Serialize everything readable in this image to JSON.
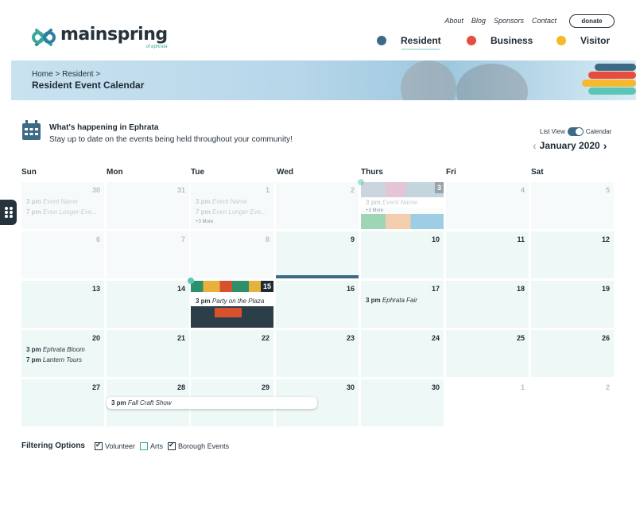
{
  "brand": {
    "name": "mainspring",
    "tagline": "of ephrata"
  },
  "top_links": [
    "About",
    "Blog",
    "Sponsors",
    "Contact"
  ],
  "donate_label": "donate",
  "main_nav": [
    {
      "label": "Resident",
      "color": "#3d6a85"
    },
    {
      "label": "Business",
      "color": "#e74c3c"
    },
    {
      "label": "Visitor",
      "color": "#f5b82e"
    }
  ],
  "banner": {
    "breadcrumb": "Home > Resident >",
    "title": "Resident Event Calendar"
  },
  "intro": {
    "title": "What's happening in Ephrata",
    "subtitle": "Stay up to date on the events being held throughout your community!"
  },
  "view_toggle": {
    "left": "List View",
    "right": "Calendar"
  },
  "month_label": "January 2020",
  "days_of_week": [
    "Sun",
    "Mon",
    "Tue",
    "Wed",
    "Thurs",
    "Fri",
    "Sat"
  ],
  "weeks": [
    [
      {
        "n": "30",
        "style": "faded",
        "events": [
          [
            "3 pm",
            "Event Name"
          ],
          [
            "7 pm",
            "Even Longer Eve..."
          ]
        ]
      },
      {
        "n": "31",
        "style": "faded",
        "events": []
      },
      {
        "n": "1",
        "style": "faded",
        "events": [
          [
            "3 pm",
            "Event Name"
          ],
          [
            "7 pm",
            "Even Longer Eve..."
          ]
        ],
        "more": "+3 More"
      },
      {
        "n": "2",
        "style": "faded",
        "events": []
      },
      {
        "n": "3",
        "style": "image-faded",
        "events": [
          [
            "3 pm",
            "Event Name"
          ]
        ],
        "more": "+3 More"
      },
      {
        "n": "4",
        "style": "faded",
        "events": []
      },
      {
        "n": "5",
        "style": "faded",
        "events": []
      }
    ],
    [
      {
        "n": "6",
        "style": "faded",
        "events": []
      },
      {
        "n": "7",
        "style": "faded",
        "events": []
      },
      {
        "n": "8",
        "style": "faded",
        "events": []
      },
      {
        "n": "9",
        "style": "normal",
        "events": []
      },
      {
        "n": "10",
        "style": "normal",
        "events": []
      },
      {
        "n": "11",
        "style": "normal",
        "events": []
      },
      {
        "n": "12",
        "style": "normal",
        "events": []
      }
    ],
    [
      {
        "n": "13",
        "style": "normal",
        "events": []
      },
      {
        "n": "14",
        "style": "normal",
        "events": []
      },
      {
        "n": "15",
        "style": "image",
        "events": [
          [
            "3 pm",
            "Party on the Plaza"
          ]
        ]
      },
      {
        "n": "16",
        "style": "normal",
        "events": []
      },
      {
        "n": "17",
        "style": "normal",
        "events": [
          [
            "3 pm",
            "Ephrata Fair"
          ]
        ]
      },
      {
        "n": "18",
        "style": "normal",
        "events": []
      },
      {
        "n": "19",
        "style": "normal",
        "events": []
      }
    ],
    [
      {
        "n": "20",
        "style": "normal",
        "events": [
          [
            "3 pm",
            "Ephrata Bloom"
          ],
          [
            "7 pm",
            "Lantern Tours"
          ]
        ]
      },
      {
        "n": "21",
        "style": "normal",
        "events": []
      },
      {
        "n": "22",
        "style": "normal",
        "events": []
      },
      {
        "n": "23",
        "style": "normal",
        "events": []
      },
      {
        "n": "24",
        "style": "normal",
        "events": []
      },
      {
        "n": "25",
        "style": "normal",
        "events": []
      },
      {
        "n": "26",
        "style": "normal",
        "events": []
      }
    ],
    [
      {
        "n": "27",
        "style": "normal",
        "events": []
      },
      {
        "n": "28",
        "style": "normal",
        "events": []
      },
      {
        "n": "29",
        "style": "normal",
        "events": []
      },
      {
        "n": "30",
        "style": "normal",
        "events": []
      },
      {
        "n": "30",
        "style": "normal",
        "events": []
      },
      {
        "n": "1",
        "style": "white",
        "events": []
      },
      {
        "n": "2",
        "style": "white",
        "events": []
      }
    ]
  ],
  "multi_day_event": {
    "time": "3 pm",
    "name": "Fall Craft Show"
  },
  "filters": {
    "title": "Filtering Options",
    "items": [
      {
        "label": "Volunteer",
        "checked": true
      },
      {
        "label": "Arts",
        "checked": false
      },
      {
        "label": "Borough Events",
        "checked": true
      }
    ]
  }
}
